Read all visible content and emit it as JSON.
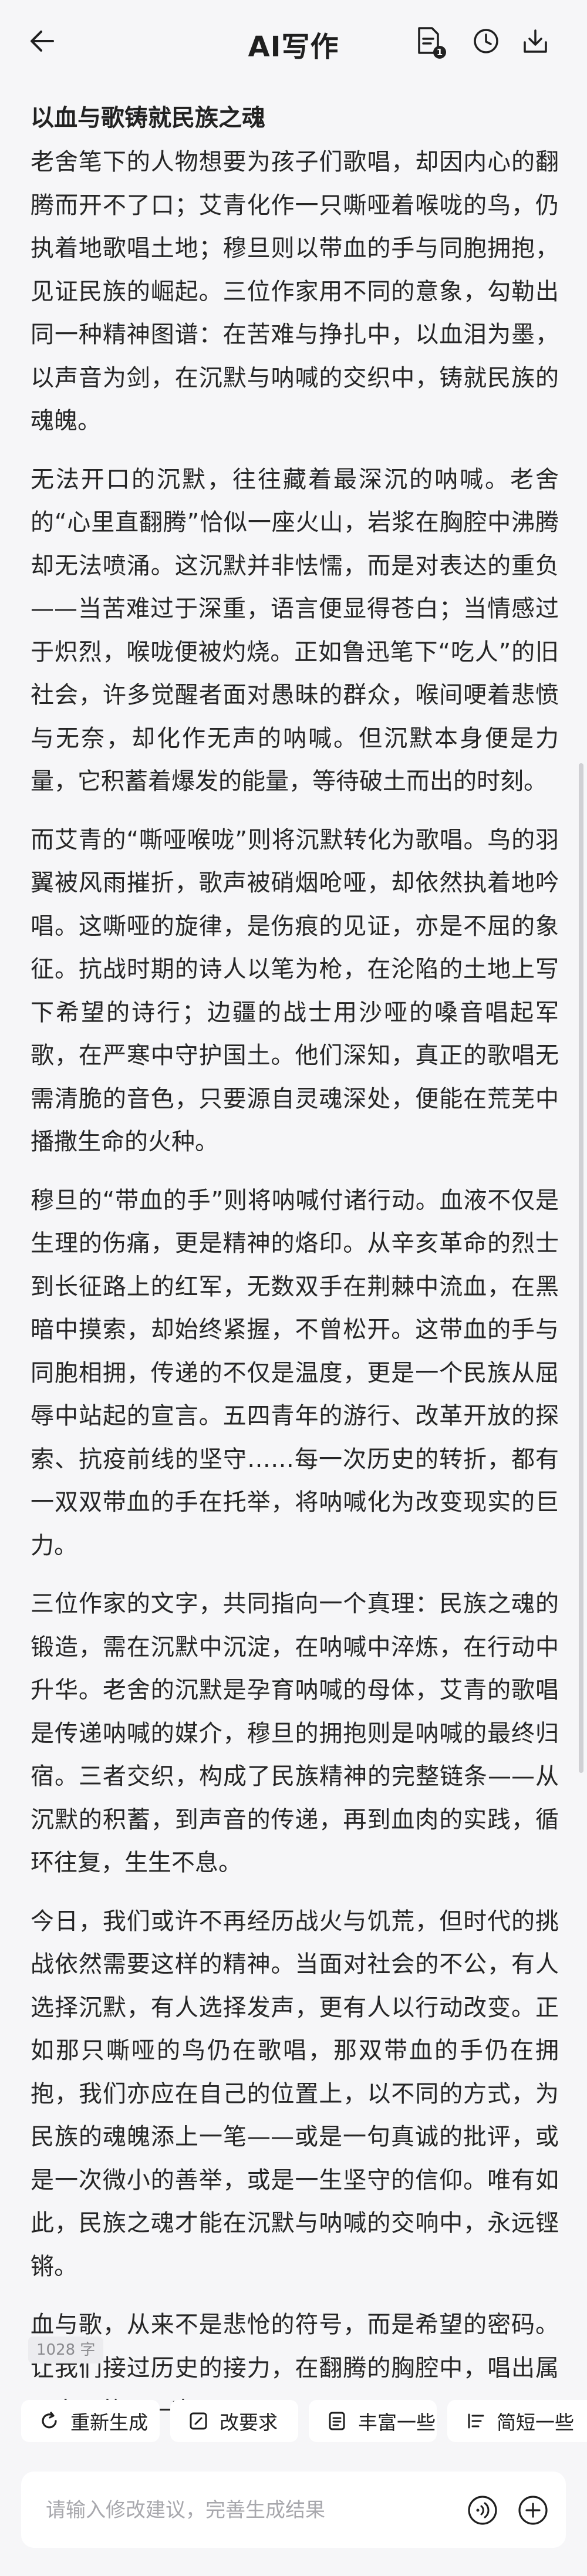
{
  "header": {
    "title": "AI写作",
    "badge_count": "1",
    "icons": [
      "back-arrow-icon",
      "document-icon",
      "history-clock-icon",
      "export-icon"
    ]
  },
  "article": {
    "title": "以血与歌铸就民族之魂",
    "paragraphs": [
      "老舍笔下的人物想要为孩子们歌唱，却因内心的翻腾而开不了口；艾青化作一只嘶哑着喉咙的鸟，仍执着地歌唱土地；穆旦则以带血的手与同胞拥抱，见证民族的崛起。三位作家用不同的意象，勾勒出同一种精神图谱：在苦难与挣扎中，以血泪为墨，以声音为剑，在沉默与呐喊的交织中，铸就民族的魂魄。",
      "无法开口的沉默，往往藏着最深沉的呐喊。老舍的“心里直翻腾”恰似一座火山，岩浆在胸腔中沸腾却无法喷涌。这沉默并非怯懦，而是对表达的重负——当苦难过于深重，语言便显得苍白；当情感过于炽烈，喉咙便被灼烧。正如鲁迅笔下“吃人”的旧社会，许多觉醒者面对愚昧的群众，喉间哽着悲愤与无奈，却化作无声的呐喊。但沉默本身便是力量，它积蓄着爆发的能量，等待破土而出的时刻。",
      "而艾青的“嘶哑喉咙”则将沉默转化为歌唱。鸟的羽翼被风雨摧折，歌声被硝烟呛哑，却依然执着地吟唱。这嘶哑的旋律，是伤痕的见证，亦是不屈的象征。抗战时期的诗人以笔为枪，在沦陷的土地上写下希望的诗行；边疆的战士用沙哑的嗓音唱起军歌，在严寒中守护国土。他们深知，真正的歌唱无需清脆的音色，只要源自灵魂深处，便能在荒芜中播撒生命的火种。",
      "穆旦的“带血的手”则将呐喊付诸行动。血液不仅是生理的伤痛，更是精神的烙印。从辛亥革命的烈士到长征路上的红军，无数双手在荆棘中流血，在黑暗中摸索，却始终紧握，不曾松开。这带血的手与同胞相拥，传递的不仅是温度，更是一个民族从屈辱中站起的宣言。五四青年的游行、改革开放的探索、抗疫前线的坚守……每一次历史的转折，都有一双双带血的手在托举，将呐喊化为改变现实的巨力。",
      "三位作家的文字，共同指向一个真理：民族之魂的锻造，需在沉默中沉淀，在呐喊中淬炼，在行动中升华。老舍的沉默是孕育呐喊的母体，艾青的歌唱是传递呐喊的媒介，穆旦的拥抱则是呐喊的最终归宿。三者交织，构成了民族精神的完整链条——从沉默的积蓄，到声音的传递，再到血肉的实践，循环往复，生生不息。",
      "今日，我们或许不再经历战火与饥荒，但时代的挑战依然需要这样的精神。当面对社会的不公，有人选择沉默，有人选择发声，更有人以行动改变。正如那只嘶哑的鸟仍在歌唱，那双带血的手仍在拥抱，我们亦应在自己的位置上，以不同的方式，为民族的魂魄添上一笔——或是一句真诚的批评，或是一次微小的善举，或是一生坚守的信仰。唯有如此，民族之魂才能在沉默与呐喊的交响中，永远铿锵。",
      "血与歌，从来不是悲怆的符号，而是希望的密码。让我们接过历史的接力，在翻腾的胸腔中，唱出属于自己的那一声。"
    ],
    "word_count": "1028 字"
  },
  "actions": [
    {
      "label": "重新生成",
      "icon": "regenerate-icon"
    },
    {
      "label": "改要求",
      "icon": "edit-icon"
    },
    {
      "label": "丰富一些",
      "icon": "enrich-icon"
    },
    {
      "label": "简短一些",
      "icon": "shorten-icon"
    }
  ],
  "input": {
    "placeholder": "请输入修改建议，完善生成结果",
    "value": ""
  }
}
